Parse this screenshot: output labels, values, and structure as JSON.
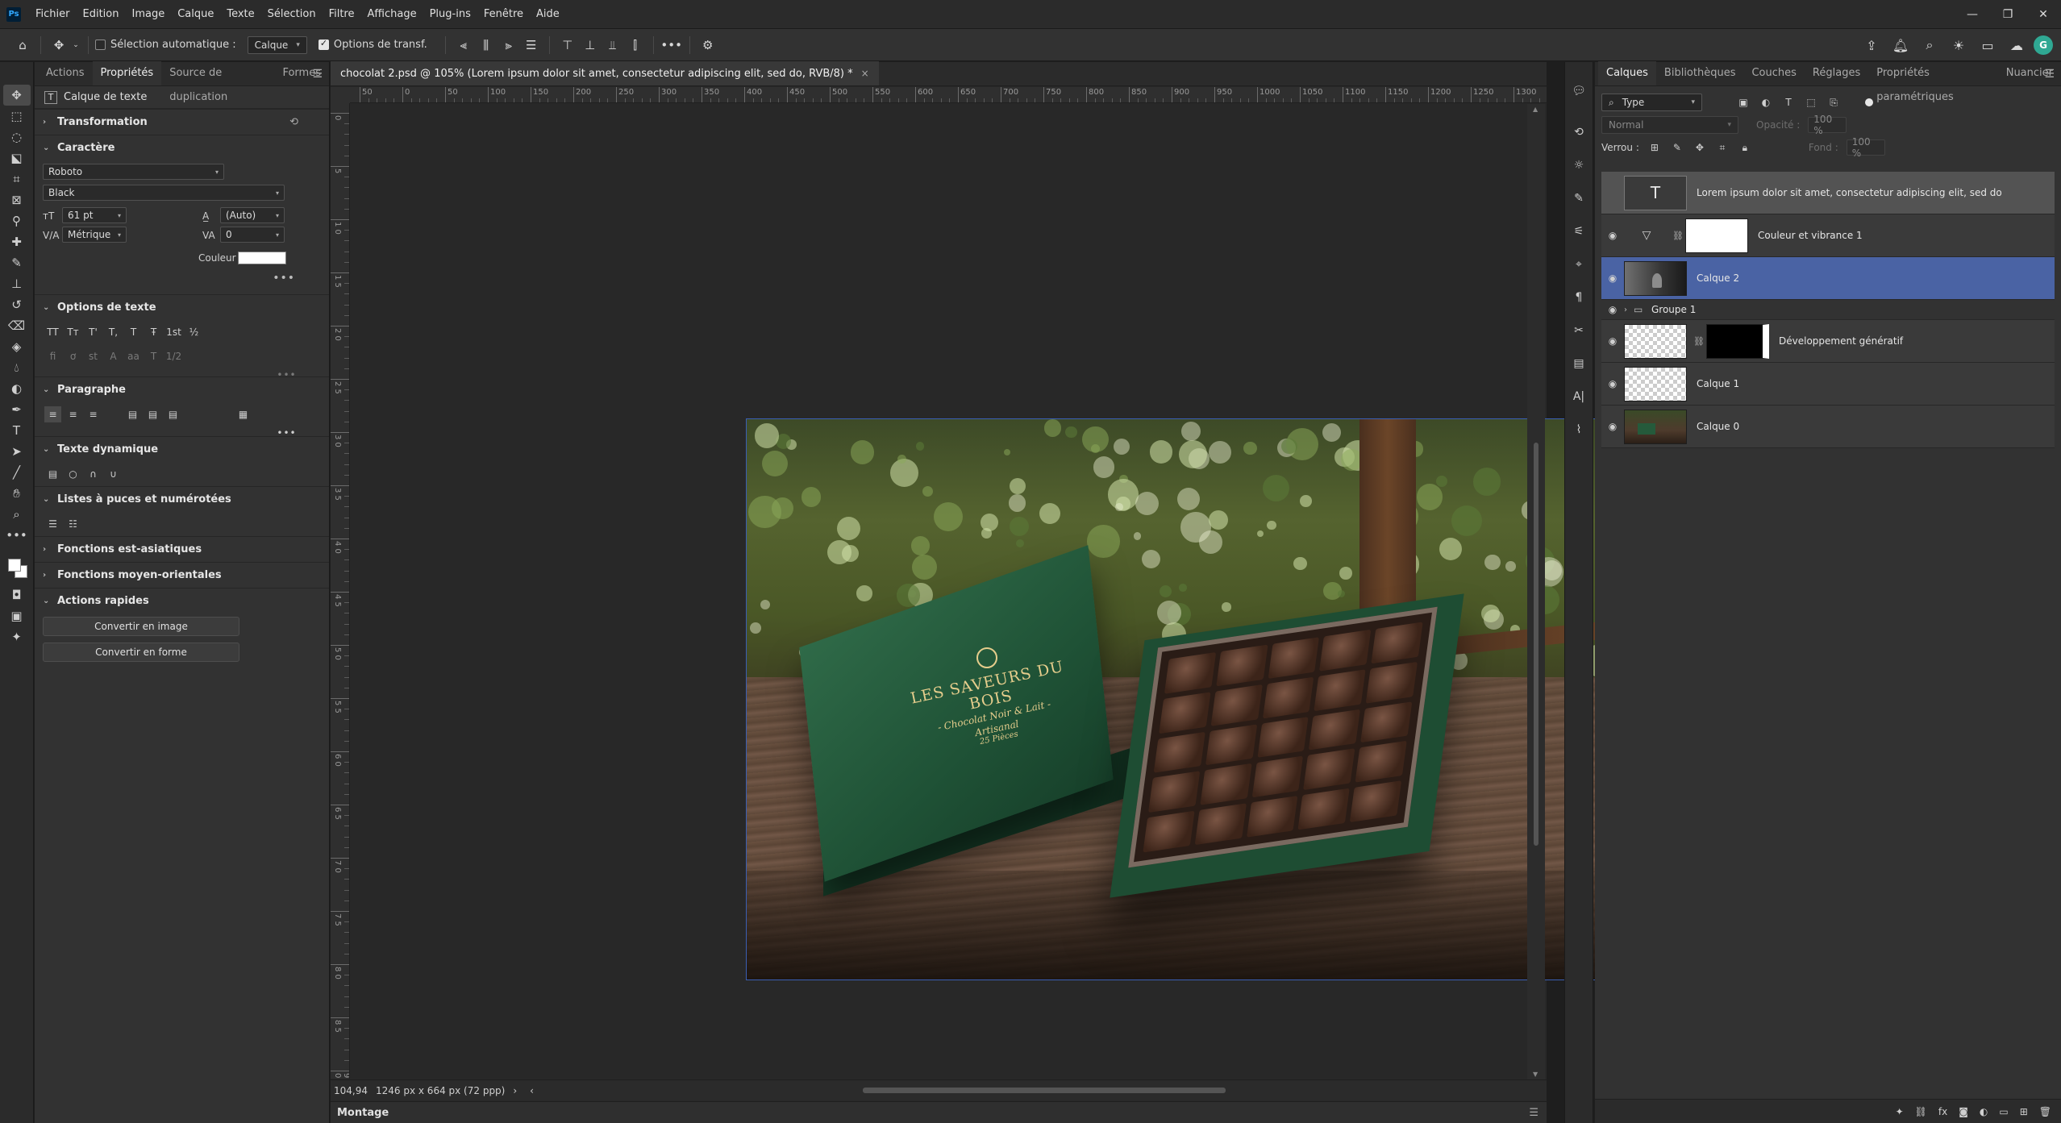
{
  "app": {
    "logo": "Ps",
    "menu": [
      "Fichier",
      "Edition",
      "Image",
      "Calque",
      "Texte",
      "Sélection",
      "Filtre",
      "Affichage",
      "Plug-ins",
      "Fenêtre",
      "Aide"
    ],
    "window_controls": [
      "—",
      "❐",
      "✕"
    ]
  },
  "options_bar": {
    "auto_select_label": "Sélection automatique :",
    "auto_select_checked": false,
    "target_value": "Calque",
    "transform_label": "Options de transf.",
    "transform_checked": true,
    "avatar_initial": "G"
  },
  "left_panel": {
    "tabs": [
      "Actions",
      "Propriétés",
      "Source de duplication",
      "Formes"
    ],
    "active_tab": "Propriétés",
    "layer_type": "Calque de texte",
    "sections": {
      "transformation": "Transformation",
      "caractere": "Caractère",
      "options_texte": "Options de texte",
      "paragraphe": "Paragraphe",
      "texte_dynamique": "Texte dynamique",
      "listes": "Listes à puces et numérotées",
      "est_asiatiques": "Fonctions est-asiatiques",
      "moyen_orientales": "Fonctions moyen-orientales",
      "actions_rapides": "Actions rapides"
    },
    "character": {
      "font_family": "Roboto",
      "font_style": "Black",
      "font_size": "61 pt",
      "leading": "(Auto)",
      "kerning": "Métrique",
      "tracking": "0",
      "color_label": "Couleur",
      "color_value": "#ffffff"
    },
    "text_option_icons": [
      "TT",
      "Tт",
      "T'",
      "T,",
      "T",
      "Ŧ",
      "1st",
      "½"
    ],
    "text_option_icons_row2": [
      "fi",
      "ơ",
      "st",
      "A",
      "aa",
      "T",
      "1/2"
    ],
    "quick_actions": {
      "convert_image": "Convertir en image",
      "convert_shape": "Convertir en forme"
    }
  },
  "document": {
    "tab_title": "chocolat 2.psd @ 105% (Lorem ipsum dolor sit amet, consectetur adipiscing elit, sed do, RVB/8) *",
    "ruler_labels_h": [
      "50",
      "0",
      "50",
      "100",
      "150",
      "200",
      "250",
      "300",
      "350",
      "400",
      "450",
      "500",
      "550",
      "600",
      "650",
      "700",
      "750",
      "800",
      "850",
      "900",
      "950",
      "1000",
      "1050",
      "1100",
      "1150",
      "1200",
      "1250",
      "1300"
    ],
    "ruler_labels_v": [
      "0",
      "5",
      "1 0",
      "1 5",
      "2 0",
      "2 5",
      "3 0",
      "3 5",
      "4 0",
      "4 5",
      "5 0",
      "5 5",
      "6 0",
      "6 5",
      "7 0",
      "7 5",
      "8 0",
      "8 5",
      "9 0"
    ],
    "zoom": "104,94",
    "doc_info": "1246 px x 664 px (72 ppp)",
    "artwork": {
      "lid_title": "LES SAVEURS DU BOIS",
      "lid_sub1": "- Chocolat Noir & Lait -",
      "lid_sub2": "Artisanal",
      "lid_sub3": "25 Pièces"
    },
    "timeline_label": "Montage"
  },
  "layers_panel": {
    "tabs": [
      "Calques",
      "Bibliothèques",
      "Couches",
      "Réglages",
      "Propriétés paramétriques",
      "Nuancier"
    ],
    "active_tab": "Calques",
    "filter_type": "Type",
    "blend_mode": "Normal",
    "opacity_label": "Opacité :",
    "opacity_value": "100 %",
    "lock_label": "Verrou :",
    "fill_label": "Fond :",
    "fill_value": "100 %",
    "layers": [
      {
        "name": "Lorem ipsum dolor sit amet, consectetur adipiscing elit, sed do",
        "kind": "text",
        "visible": false
      },
      {
        "name": "Couleur et vibrance 1",
        "kind": "adjustment",
        "visible": true
      },
      {
        "name": "Calque 2",
        "kind": "pixel",
        "visible": true,
        "selected": true
      },
      {
        "name": "Groupe 1",
        "kind": "group",
        "visible": true
      },
      {
        "name": "Développement génératif",
        "kind": "generative",
        "visible": true
      },
      {
        "name": "Calque 1",
        "kind": "pixel",
        "visible": true
      },
      {
        "name": "Calque 0",
        "kind": "pixel",
        "visible": true
      }
    ]
  }
}
